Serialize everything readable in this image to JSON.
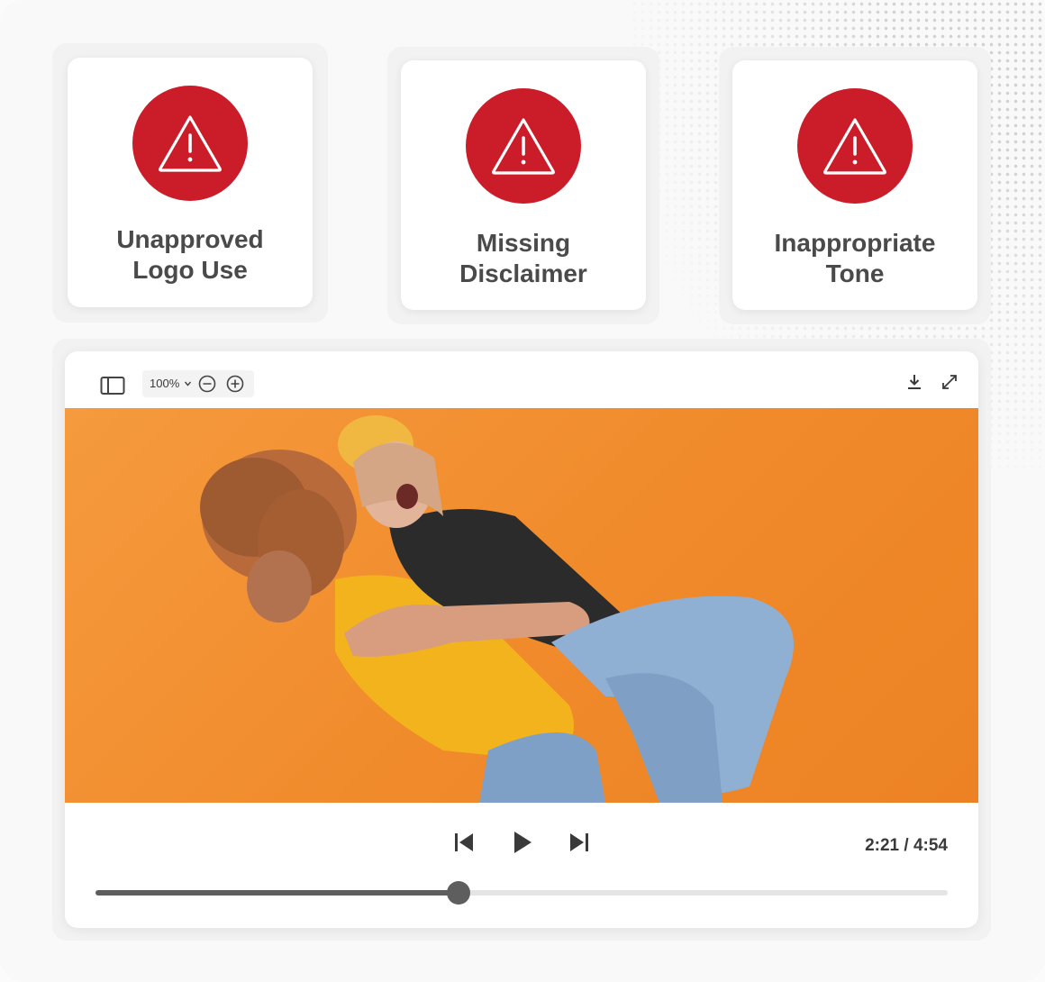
{
  "colors": {
    "alert": "#cb1d29",
    "video_bg": "#f28c2d",
    "progress": "#5e5e5e"
  },
  "alerts": [
    {
      "icon": "warning-icon",
      "line1": "Unapproved",
      "line2": "Logo Use"
    },
    {
      "icon": "warning-icon",
      "line1": "Missing",
      "line2": "Disclaimer"
    },
    {
      "icon": "warning-icon",
      "line1": "Inappropriate",
      "line2": "Tone"
    }
  ],
  "toolbar": {
    "zoom_label": "100%",
    "icons": [
      "sidebar-toggle-icon",
      "chevron-down-icon",
      "zoom-out-icon",
      "zoom-in-icon",
      "download-icon",
      "fullscreen-icon"
    ]
  },
  "player": {
    "time_display": "2:21 / 4:54",
    "progress": 0.4263,
    "icons": [
      "skip-previous-icon",
      "play-icon",
      "skip-next-icon"
    ]
  }
}
